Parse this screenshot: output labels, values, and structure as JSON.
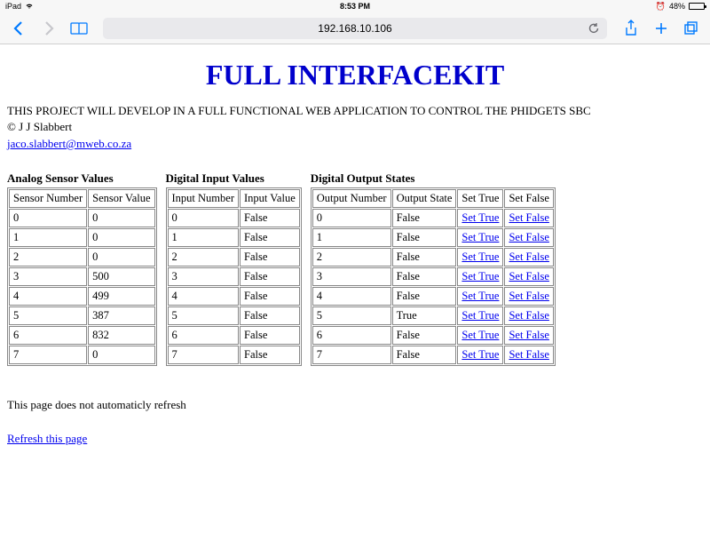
{
  "statusBar": {
    "device": "iPad",
    "time": "8:53 PM",
    "battery": "48%"
  },
  "navBar": {
    "url": "192.168.10.106"
  },
  "page": {
    "title": "FULL INTERFACEKIT",
    "description": "THIS PROJECT WILL DEVELOP IN A FULL FUNCTIONAL WEB APPLICATION TO CONTROL THE PHIDGETS SBC",
    "copyright": "© J J Slabbert",
    "email": "jaco.slabbert@mweb.co.za",
    "note": "This page does not automaticly refresh",
    "refreshLink": "Refresh this page"
  },
  "tables": {
    "analog": {
      "title": "Analog Sensor Values",
      "headers": [
        "Sensor Number",
        "Sensor Value"
      ],
      "rows": [
        {
          "num": "0",
          "val": "0"
        },
        {
          "num": "1",
          "val": "0"
        },
        {
          "num": "2",
          "val": "0"
        },
        {
          "num": "3",
          "val": "500"
        },
        {
          "num": "4",
          "val": "499"
        },
        {
          "num": "5",
          "val": "387"
        },
        {
          "num": "6",
          "val": "832"
        },
        {
          "num": "7",
          "val": "0"
        }
      ]
    },
    "digitalInput": {
      "title": "Digital Input Values",
      "headers": [
        "Input Number",
        "Input Value"
      ],
      "rows": [
        {
          "num": "0",
          "val": "False"
        },
        {
          "num": "1",
          "val": "False"
        },
        {
          "num": "2",
          "val": "False"
        },
        {
          "num": "3",
          "val": "False"
        },
        {
          "num": "4",
          "val": "False"
        },
        {
          "num": "5",
          "val": "False"
        },
        {
          "num": "6",
          "val": "False"
        },
        {
          "num": "7",
          "val": "False"
        }
      ]
    },
    "digitalOutput": {
      "title": "Digital Output States",
      "headers": [
        "Output Number",
        "Output State",
        "Set True",
        "Set False"
      ],
      "setTrueLabel": "Set True",
      "setFalseLabel": "Set False",
      "rows": [
        {
          "num": "0",
          "state": "False"
        },
        {
          "num": "1",
          "state": "False"
        },
        {
          "num": "2",
          "state": "False"
        },
        {
          "num": "3",
          "state": "False"
        },
        {
          "num": "4",
          "state": "False"
        },
        {
          "num": "5",
          "state": "True"
        },
        {
          "num": "6",
          "state": "False"
        },
        {
          "num": "7",
          "state": "False"
        }
      ]
    }
  }
}
